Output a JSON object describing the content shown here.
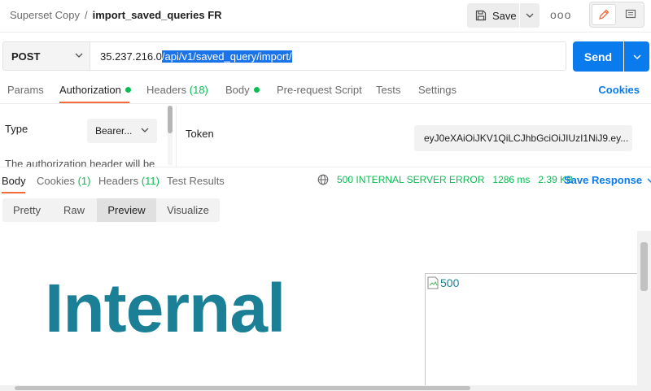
{
  "header": {
    "collection": "Superset Copy",
    "separator": "/",
    "request_name": "import_saved_queries FR",
    "save_label": "Save",
    "more_label": "ooo"
  },
  "request": {
    "method": "POST",
    "url_host": "35.237.216.0",
    "url_path": "/api/v1/saved_query/import/",
    "send_label": "Send"
  },
  "request_tabs": [
    {
      "label": "Params",
      "count": ""
    },
    {
      "label": "Authorization",
      "count": ""
    },
    {
      "label": "Headers",
      "count": "(18)"
    },
    {
      "label": "Body",
      "count": ""
    },
    {
      "label": "Pre-request Script",
      "count": ""
    },
    {
      "label": "Tests",
      "count": ""
    },
    {
      "label": "Settings",
      "count": ""
    }
  ],
  "cookies_label": "Cookies",
  "auth": {
    "type_label": "Type",
    "type_value": "Bearer...",
    "note": "The authorization header will be",
    "token_label": "Token",
    "token_value": "eyJ0eXAiOiJKV1QiLCJhbGciOiJIUzI1NiJ9.ey..."
  },
  "response_tabs": [
    {
      "label": "Body",
      "count": ""
    },
    {
      "label": "Cookies",
      "count": "(1)"
    },
    {
      "label": "Headers",
      "count": "(11)"
    },
    {
      "label": "Test Results",
      "count": ""
    }
  ],
  "status": {
    "code": "500 INTERNAL SERVER ERROR",
    "time": "1286 ms",
    "size": "2.39 KB",
    "save_response_label": "Save Response"
  },
  "view_modes": [
    "Pretty",
    "Raw",
    "Preview",
    "Visualize"
  ],
  "preview": {
    "heading": "Internal",
    "image_alt": "500"
  },
  "colors": {
    "accent_orange": "#f26b3a",
    "send_blue": "#097bed",
    "status_green": "#0cbb52",
    "preview_teal": "#1b7f96"
  }
}
